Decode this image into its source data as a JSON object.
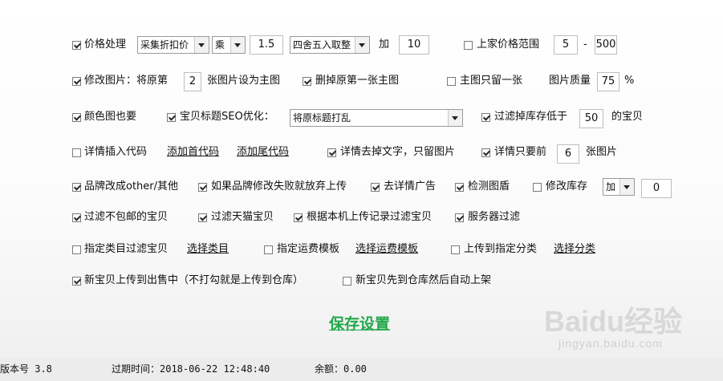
{
  "row1": {
    "price_label": "价格处理",
    "mode_select": "采集折扣价",
    "op_select": "乘",
    "multiplier": "1.5",
    "round_select": "四舍五入取整",
    "add_label": "加",
    "add_value": "10",
    "range_label": "上家价格范围",
    "range_min": "5",
    "range_sep": "-",
    "range_max": "500"
  },
  "row2": {
    "modify_label": "修改图片：将原第",
    "index_value": "2",
    "index_suffix": "张图片设为主图",
    "delete_label": "删掉原第一张主图",
    "keep_one_label": "主图只留一张",
    "quality_label": "图片质量",
    "quality_value": "75",
    "quality_unit": "%"
  },
  "row3": {
    "color_label": "颜色图也要",
    "seo_label": "宝贝标题SEO优化：",
    "seo_select": "将原标题打乱",
    "stock_label": "过滤掉库存低于",
    "stock_value": "50",
    "stock_suffix": "的宝贝"
  },
  "row4": {
    "insert_code_label": "详情插入代码",
    "add_head_link": "添加首代码",
    "add_tail_link": "添加尾代码",
    "remove_text_label": "详情去掉文字，只留图片",
    "first_only_label": "详情只要前",
    "first_count": "6",
    "first_suffix": "张图片"
  },
  "row5": {
    "brand_label": "品牌改成other/其他",
    "brand_fail_label": "如果品牌修改失败就放弃上传",
    "remove_ad_label": "去详情广告",
    "detect_shield_label": "检测图盾",
    "modify_stock_label": "修改库存",
    "stock_op": "加",
    "stock_delta": "0"
  },
  "row6": {
    "free_ship_label": "过滤不包邮的宝贝",
    "tmall_label": "过滤天猫宝贝",
    "local_record_label": "根据本机上传记录过滤宝贝",
    "server_filter_label": "服务器过滤"
  },
  "row7": {
    "category_filter_label": "指定类目过滤宝贝",
    "choose_category_link": "选择类目",
    "shipping_label": "指定运费模板",
    "choose_shipping_link": "选择运费模板",
    "upload_category_label": "上传到指定分类",
    "choose_class_link": "选择分类"
  },
  "row8": {
    "sell_label": "新宝贝上传到出售中（不打勾就是上传到仓库）",
    "auto_list_label": "新宝贝先到仓库然后自动上架"
  },
  "save_label": "保存设置",
  "status": {
    "version": "版本号 3.8",
    "expire": "过期时间：2018-06-22 12:48:40",
    "balance": "余额：0.00"
  },
  "watermark": {
    "brand": "Baidu经验",
    "url": "jingyan.baidu.com"
  },
  "colors": {
    "save_green": "#22a84a",
    "status_bg": "#ececec"
  }
}
